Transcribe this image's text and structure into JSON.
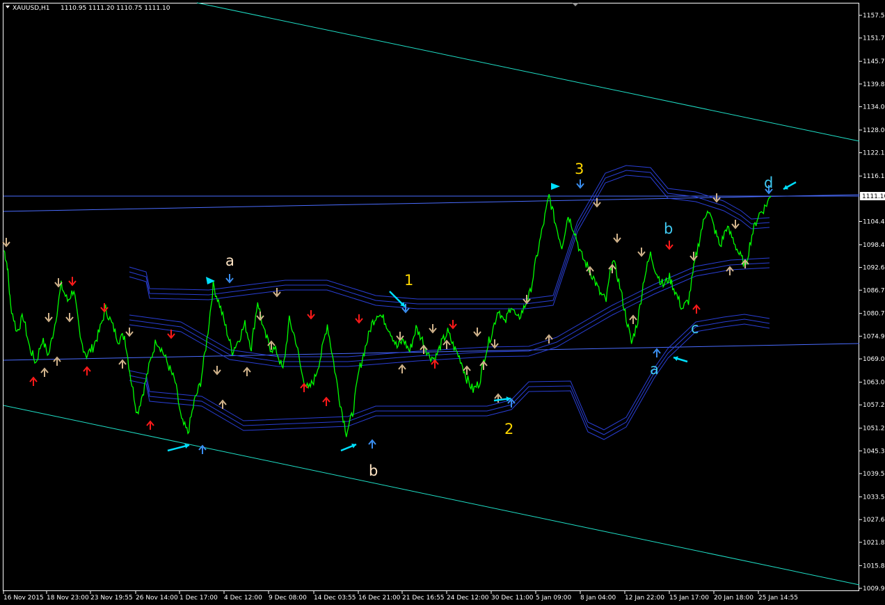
{
  "header": {
    "symbol": "XAUUSD,H1",
    "ohlc": "1110.95 1111.20 1110.75 1111.10"
  },
  "colors": {
    "background": "#000000",
    "frame": "#ffffff",
    "price_line": "#00ff00",
    "envelope_bands": "#2a3fd6",
    "channel_lines": "#1fe0c8",
    "horizontal_lines": "#4a6cff",
    "arrow_up_tan": "#d2b48c",
    "arrow_down_tan": "#d2b48c",
    "arrow_red": "#ff1a1a",
    "arrow_blue": "#3a8ef0",
    "pointer_cyan": "#00e0ff",
    "wave_yellow": "#ffd700",
    "wave_white": "#ffe4c4",
    "wave_cyan": "#40c8f0"
  },
  "chart_data": {
    "type": "line",
    "x_ticks": [
      "16 Nov 2015",
      "18 Nov 23:00",
      "23 Nov 19:55",
      "26 Nov 14:00",
      "1 Dec 17:00",
      "4 Dec 12:00",
      "9 Dec 08:00",
      "14 Dec 03:55",
      "16 Dec 21:00",
      "21 Dec 16:55",
      "24 Dec 12:00",
      "30 Dec 11:00",
      "5 Jan 09:00",
      "8 Jan 04:00",
      "12 Jan 22:00",
      "15 Jan 17:00",
      "20 Jan 18:00",
      "25 Jan 14:55"
    ],
    "y_ticks": [
      "1157.55",
      "1151.70",
      "1145.70",
      "1139.85",
      "1134.00",
      "1128.00",
      "1122.15",
      "1116.15",
      "1104.45",
      "1098.45",
      "1092.60",
      "1086.75",
      "1080.75",
      "1074.90",
      "1069.05",
      "1063.05",
      "1057.20",
      "1051.20",
      "1045.35",
      "1039.50",
      "1033.50",
      "1027.65",
      "1021.80",
      "1015.80",
      "1009.95"
    ],
    "current_price_label": "1111.10",
    "ylim": [
      1009.95,
      1157.55
    ],
    "price_path": [
      [
        0,
        1097
      ],
      [
        0.5,
        1093
      ],
      [
        1,
        1083
      ],
      [
        2,
        1076
      ],
      [
        3,
        1080
      ],
      [
        4,
        1072
      ],
      [
        5,
        1068
      ],
      [
        6,
        1074
      ],
      [
        7,
        1070
      ],
      [
        8,
        1078
      ],
      [
        9,
        1088
      ],
      [
        10,
        1084
      ],
      [
        11,
        1087
      ],
      [
        12,
        1074
      ],
      [
        13,
        1070
      ],
      [
        14,
        1072
      ],
      [
        15,
        1076
      ],
      [
        16,
        1082
      ],
      [
        17,
        1078
      ],
      [
        18,
        1074
      ],
      [
        19,
        1075
      ],
      [
        20,
        1064
      ],
      [
        21,
        1055
      ],
      [
        22,
        1061
      ],
      [
        23,
        1068
      ],
      [
        24,
        1074
      ],
      [
        25,
        1071
      ],
      [
        26,
        1067
      ],
      [
        27,
        1063
      ],
      [
        28,
        1053
      ],
      [
        29,
        1050
      ],
      [
        30,
        1058
      ],
      [
        31,
        1063
      ],
      [
        32,
        1074
      ],
      [
        33,
        1088
      ],
      [
        34,
        1083
      ],
      [
        35,
        1077
      ],
      [
        36,
        1071
      ],
      [
        37,
        1074
      ],
      [
        38,
        1078
      ],
      [
        39,
        1072
      ],
      [
        40,
        1084
      ],
      [
        41,
        1076
      ],
      [
        42,
        1072
      ],
      [
        43,
        1071
      ],
      [
        44,
        1066
      ],
      [
        45,
        1079
      ],
      [
        46,
        1074
      ],
      [
        47,
        1065
      ],
      [
        48,
        1061
      ],
      [
        49,
        1064
      ],
      [
        50,
        1070
      ],
      [
        51,
        1078
      ],
      [
        52,
        1068
      ],
      [
        53,
        1058
      ],
      [
        54,
        1050
      ],
      [
        55,
        1055
      ],
      [
        56,
        1066
      ],
      [
        57,
        1072
      ],
      [
        58,
        1078
      ],
      [
        59,
        1081
      ],
      [
        60,
        1079
      ],
      [
        61,
        1076
      ],
      [
        62,
        1072
      ],
      [
        63,
        1074
      ],
      [
        64,
        1071
      ],
      [
        65,
        1077
      ],
      [
        66,
        1074
      ],
      [
        67,
        1070
      ],
      [
        68,
        1069
      ],
      [
        69,
        1073
      ],
      [
        70,
        1076
      ],
      [
        71,
        1072
      ],
      [
        72,
        1069
      ],
      [
        73,
        1064
      ],
      [
        74,
        1061
      ],
      [
        75,
        1063
      ],
      [
        76,
        1071
      ],
      [
        77,
        1076
      ],
      [
        78,
        1082
      ],
      [
        79,
        1078
      ],
      [
        80,
        1083
      ],
      [
        81,
        1079
      ],
      [
        82,
        1082
      ],
      [
        83,
        1086
      ],
      [
        84,
        1095
      ],
      [
        85,
        1103
      ],
      [
        86,
        1111
      ],
      [
        87,
        1104
      ],
      [
        88,
        1098
      ],
      [
        89,
        1106
      ],
      [
        90,
        1102
      ],
      [
        91,
        1096
      ],
      [
        92,
        1093
      ],
      [
        93,
        1090
      ],
      [
        94,
        1086
      ],
      [
        95,
        1084
      ],
      [
        96,
        1095
      ],
      [
        97,
        1089
      ],
      [
        98,
        1081
      ],
      [
        99,
        1073
      ],
      [
        100,
        1079
      ],
      [
        101,
        1090
      ],
      [
        102,
        1096
      ],
      [
        103,
        1091
      ],
      [
        104,
        1088
      ],
      [
        105,
        1090
      ],
      [
        106,
        1086
      ],
      [
        107,
        1082
      ],
      [
        108,
        1084
      ],
      [
        109,
        1094
      ],
      [
        110,
        1102
      ],
      [
        111,
        1108
      ],
      [
        112,
        1103
      ],
      [
        113,
        1098
      ],
      [
        114,
        1103
      ],
      [
        115,
        1100
      ],
      [
        116,
        1096
      ],
      [
        117,
        1093
      ],
      [
        118,
        1101
      ],
      [
        119,
        1106
      ],
      [
        120,
        1108
      ],
      [
        121,
        1111
      ]
    ],
    "wave_labels": [
      {
        "text": "a"
      },
      {
        "text": "1"
      },
      {
        "text": "2"
      },
      {
        "text": "3"
      },
      {
        "text": "b"
      },
      {
        "text": "b"
      },
      {
        "text": "c"
      },
      {
        "text": "a"
      },
      {
        "text": "d"
      }
    ]
  }
}
